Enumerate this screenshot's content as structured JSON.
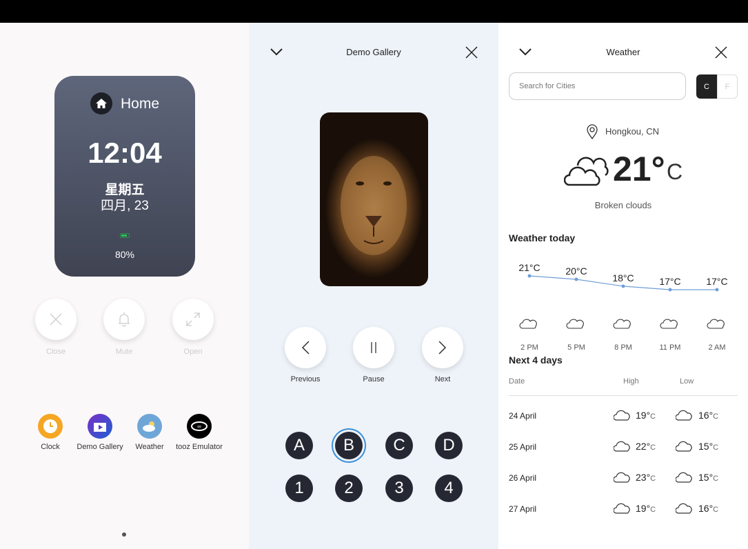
{
  "home": {
    "card": {
      "title": "Home",
      "time": "12:04",
      "weekday": "星期五",
      "date": "四月, 23",
      "battery": "80%",
      "battery_level": 0.8
    },
    "actions": [
      {
        "label": "Close",
        "icon": "close-icon"
      },
      {
        "label": "Mute",
        "icon": "bell-icon"
      },
      {
        "label": "Open",
        "icon": "expand-icon"
      }
    ],
    "apps": [
      {
        "label": "Clock",
        "color": "#f5a623"
      },
      {
        "label": "Demo Gallery",
        "color": "#4b3fc4"
      },
      {
        "label": "Weather",
        "color": "#6fa6d8"
      },
      {
        "label": "tooz Emulator",
        "color": "#000000"
      }
    ]
  },
  "gallery": {
    "title": "Demo Gallery",
    "controls": [
      {
        "label": "Previous"
      },
      {
        "label": "Pause"
      },
      {
        "label": "Next"
      }
    ],
    "letters": [
      "A",
      "B",
      "C",
      "D"
    ],
    "numbers": [
      "1",
      "2",
      "3",
      "4"
    ],
    "selected": "B",
    "accent": "#3b8fd9"
  },
  "weather": {
    "title": "Weather",
    "search_placeholder": "Search for Cities",
    "unit_c": "C",
    "unit_f": "F",
    "unit_selected": "C",
    "location": "Hongkou, CN",
    "current_temp": "21°",
    "current_unit": "C",
    "condition": "Broken clouds",
    "today_heading": "Weather today",
    "next_heading": "Next 4 days",
    "cols": {
      "date": "Date",
      "high": "High",
      "low": "Low"
    },
    "days": [
      {
        "date": "24 April",
        "high": "19°",
        "low": "16°"
      },
      {
        "date": "25 April",
        "high": "22°",
        "low": "15°"
      },
      {
        "date": "26 April",
        "high": "23°",
        "low": "15°"
      },
      {
        "date": "27 April",
        "high": "19°",
        "low": "16°"
      }
    ],
    "unit": "C"
  },
  "chart_data": {
    "type": "line",
    "categories": [
      "2 PM",
      "5 PM",
      "8 PM",
      "11 PM",
      "2 AM"
    ],
    "values": [
      21,
      20,
      18,
      17,
      17
    ],
    "labels": [
      "21°C",
      "20°C",
      "18°C",
      "17°C",
      "17°C"
    ],
    "icons": [
      "cloud",
      "cloud",
      "cloud",
      "cloud",
      "night-rain"
    ],
    "color": "#6f9fd8"
  }
}
